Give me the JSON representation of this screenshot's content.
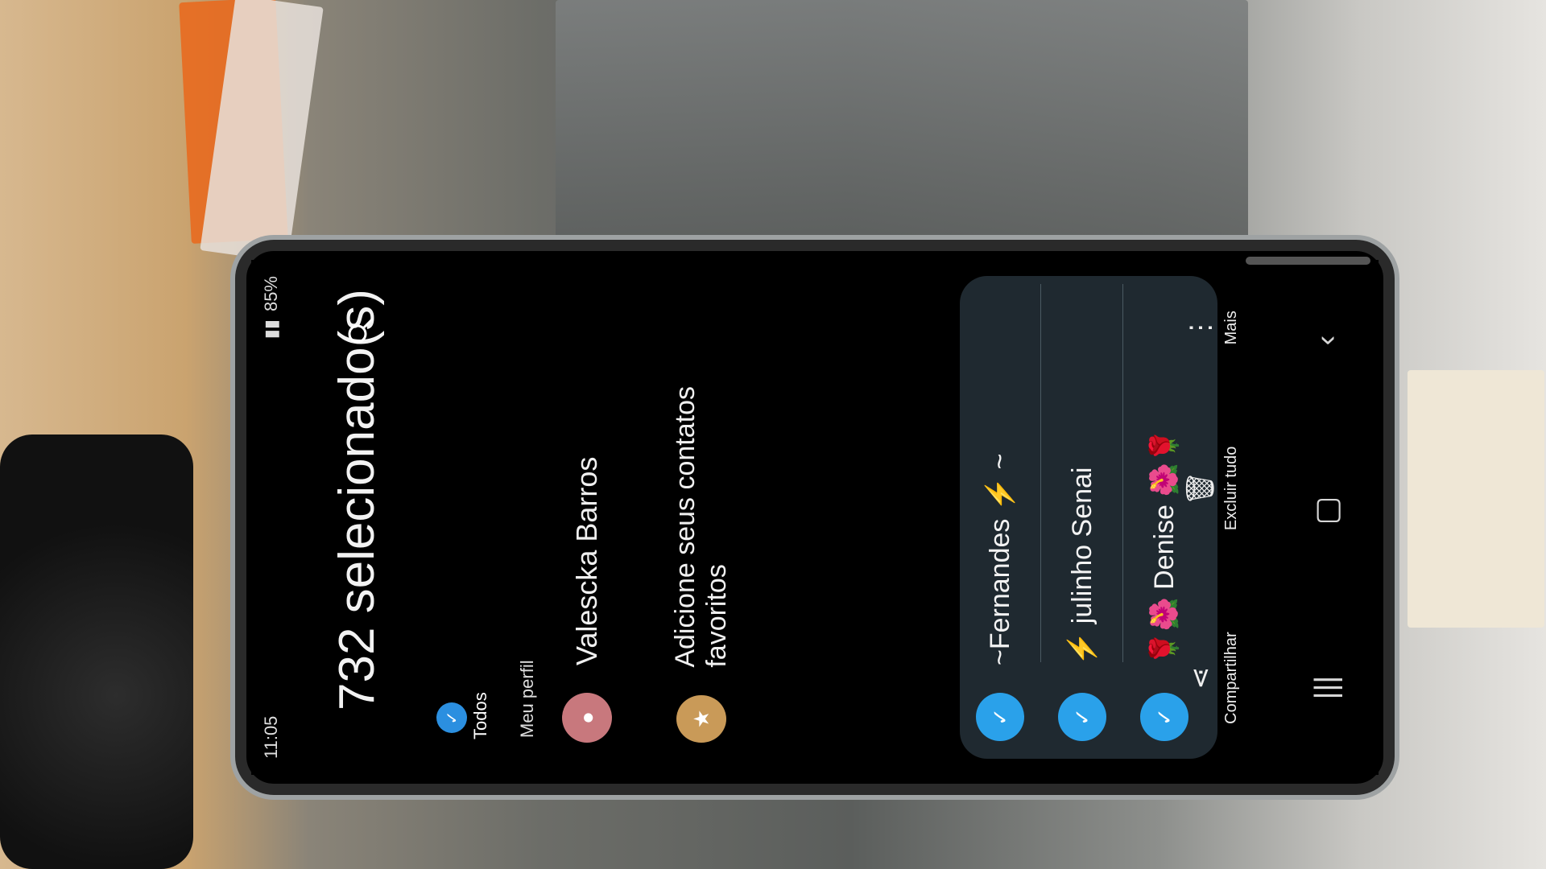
{
  "status_bar": {
    "time": "11:05",
    "battery": "85%"
  },
  "header": {
    "title": "732 selecionado(s)"
  },
  "filters": {
    "all_label": "Todos"
  },
  "sections": {
    "my_profile_label": "Meu perfil",
    "group_letter": "&"
  },
  "contacts": {
    "profile_name": "Valescka Barros",
    "favorites_prompt": "Adicione seus contatos favoritos"
  },
  "selected_list": {
    "items": [
      {
        "name": "~Fernandes ⚡ ~"
      },
      {
        "name": "⚡ julinho Senai"
      },
      {
        "name": "🌹🌺 Denise 🌺🌹"
      }
    ]
  },
  "actions": {
    "share_label": "Compartilhar",
    "delete_all_label": "Excluir tudo",
    "more_label": "Mais"
  },
  "icons": {
    "search": "search-icon",
    "check": "check-icon",
    "share": "share-icon",
    "delete": "trash-icon",
    "more": "more-icon",
    "recents": "recents-icon",
    "home": "home-icon",
    "back": "back-icon"
  },
  "colors": {
    "accent_blue": "#2aa1ea",
    "panel_bg": "#1f2930",
    "profile_avatar": "#c8787d",
    "favorites_avatar": "#c99a58"
  }
}
